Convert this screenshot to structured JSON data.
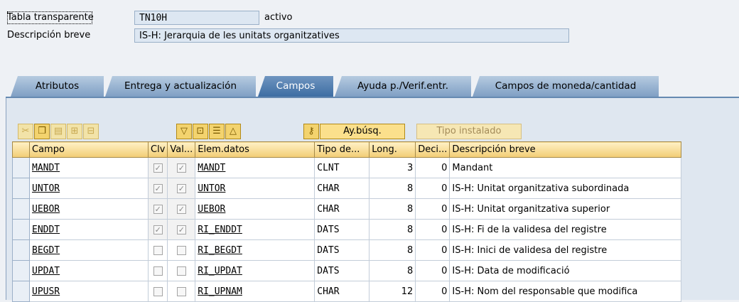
{
  "header": {
    "table_label": "Tabla transparente",
    "table_name": "TN10H",
    "status": "activo",
    "desc_label": "Descripción breve",
    "description": "IS-H: Jerarquia de les unitats organitzatives"
  },
  "tabs": [
    {
      "label": "Atributos",
      "active": false
    },
    {
      "label": "Entrega y actualización",
      "active": false
    },
    {
      "label": "Campos",
      "active": true
    },
    {
      "label": "Ayuda p./Verif.entr.",
      "active": false
    },
    {
      "label": "Campos de moneda/cantidad",
      "active": false
    }
  ],
  "toolbar": {
    "icons": [
      "cut-icon",
      "copy-icon",
      "paste-icon",
      "insert-row-icon",
      "delete-row-icon",
      "sort-down-icon",
      "add-field-icon",
      "new-row-icon",
      "sort-up-icon",
      "search-help-icon"
    ],
    "search_help_label": "Ay.búsq.",
    "builtin_type_label": "Tipo instalado"
  },
  "columns": [
    "Campo",
    "Clv",
    "Val...",
    "Elem.datos",
    "Tipo de...",
    "Long.",
    "Deci...",
    "Descripción breve"
  ],
  "rows": [
    {
      "field": "MANDT",
      "key": true,
      "initial": true,
      "element": "MANDT",
      "type": "CLNT",
      "length": "3",
      "decimals": "0",
      "description": "Mandant"
    },
    {
      "field": "UNTOR",
      "key": true,
      "initial": true,
      "element": "UNTOR",
      "type": "CHAR",
      "length": "8",
      "decimals": "0",
      "description": "IS-H: Unitat organitzativa subordinada"
    },
    {
      "field": "UEBOR",
      "key": true,
      "initial": true,
      "element": "UEBOR",
      "type": "CHAR",
      "length": "8",
      "decimals": "0",
      "description": "IS-H: Unitat organitzativa superior"
    },
    {
      "field": "ENDDT",
      "key": true,
      "initial": true,
      "element": "RI_ENDDT",
      "type": "DATS",
      "length": "8",
      "decimals": "0",
      "description": "IS-H: Fi de la validesa del registre"
    },
    {
      "field": "BEGDT",
      "key": false,
      "initial": false,
      "element": "RI_BEGDT",
      "type": "DATS",
      "length": "8",
      "decimals": "0",
      "description": "IS-H: Inici de validesa del registre"
    },
    {
      "field": "UPDAT",
      "key": false,
      "initial": false,
      "element": "RI_UPDAT",
      "type": "DATS",
      "length": "8",
      "decimals": "0",
      "description": "IS-H: Data de modificació"
    },
    {
      "field": "UPUSR",
      "key": false,
      "initial": false,
      "element": "RI_UPNAM",
      "type": "CHAR",
      "length": "12",
      "decimals": "0",
      "description": "IS-H: Nom del responsable que modifica"
    }
  ],
  "colors": {
    "tab_active": "#3d6da3",
    "tab_inactive": "#9fb8d6",
    "header_cell": "#f2cd74",
    "panel": "#dfe7f0"
  }
}
